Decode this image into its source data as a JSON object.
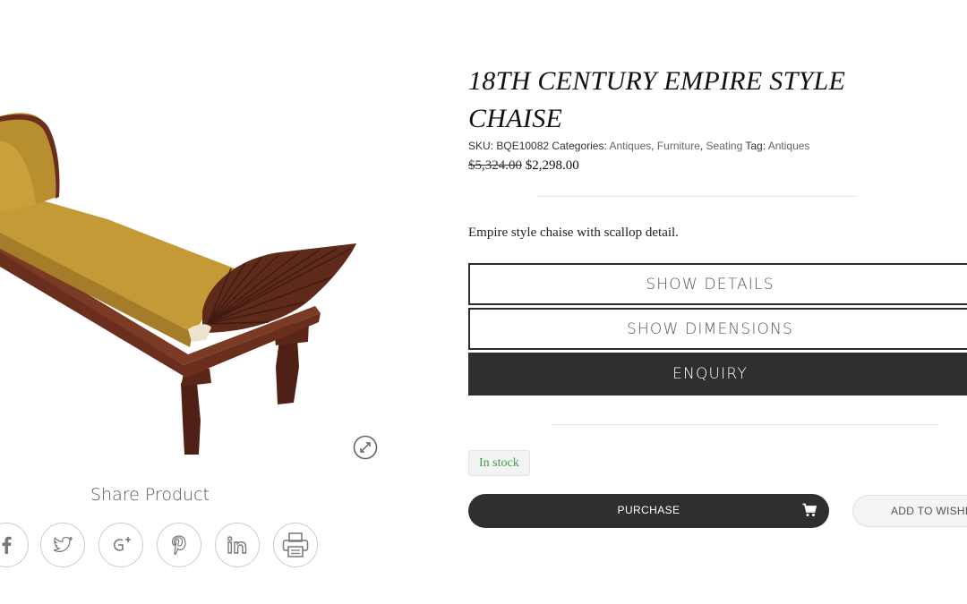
{
  "product": {
    "title": "18TH CENTURY EMPIRE STYLE CHAISE",
    "sku_label": "SKU:",
    "sku": "BQE10082",
    "categories_label": "Categories:",
    "categories": [
      "Antiques",
      "Furniture",
      "Seating"
    ],
    "tag_label": "Tag:",
    "tag": "Antiques",
    "regular_price": "$5,324.00",
    "sale_price": "$2,298.00",
    "short_description": "Empire style chaise with scallop detail."
  },
  "buttons": {
    "details": "SHOW DETAILS",
    "dimensions": "SHOW DIMENSIONS",
    "enquiry": "ENQUIRY",
    "purchase": "PURCHASE",
    "wishlist": "ADD TO WISHLIST"
  },
  "stock": {
    "label": "In stock",
    "color": "#3a9b4a"
  },
  "share": {
    "title": "Share Product",
    "networks": [
      "facebook-icon",
      "twitter-icon",
      "google-plus-icon",
      "pinterest-icon",
      "linkedin-icon",
      "print-icon"
    ]
  },
  "image": {
    "subject": "chaise",
    "upholstery_color": "#c39a35",
    "wood_color": "#5e2a1a"
  },
  "icons": {
    "zoom": "zoom-expand-icon",
    "cart": "cart-icon"
  },
  "colors": {
    "dark_button": "#2f2f2f",
    "rule": "#e6e6e6"
  }
}
